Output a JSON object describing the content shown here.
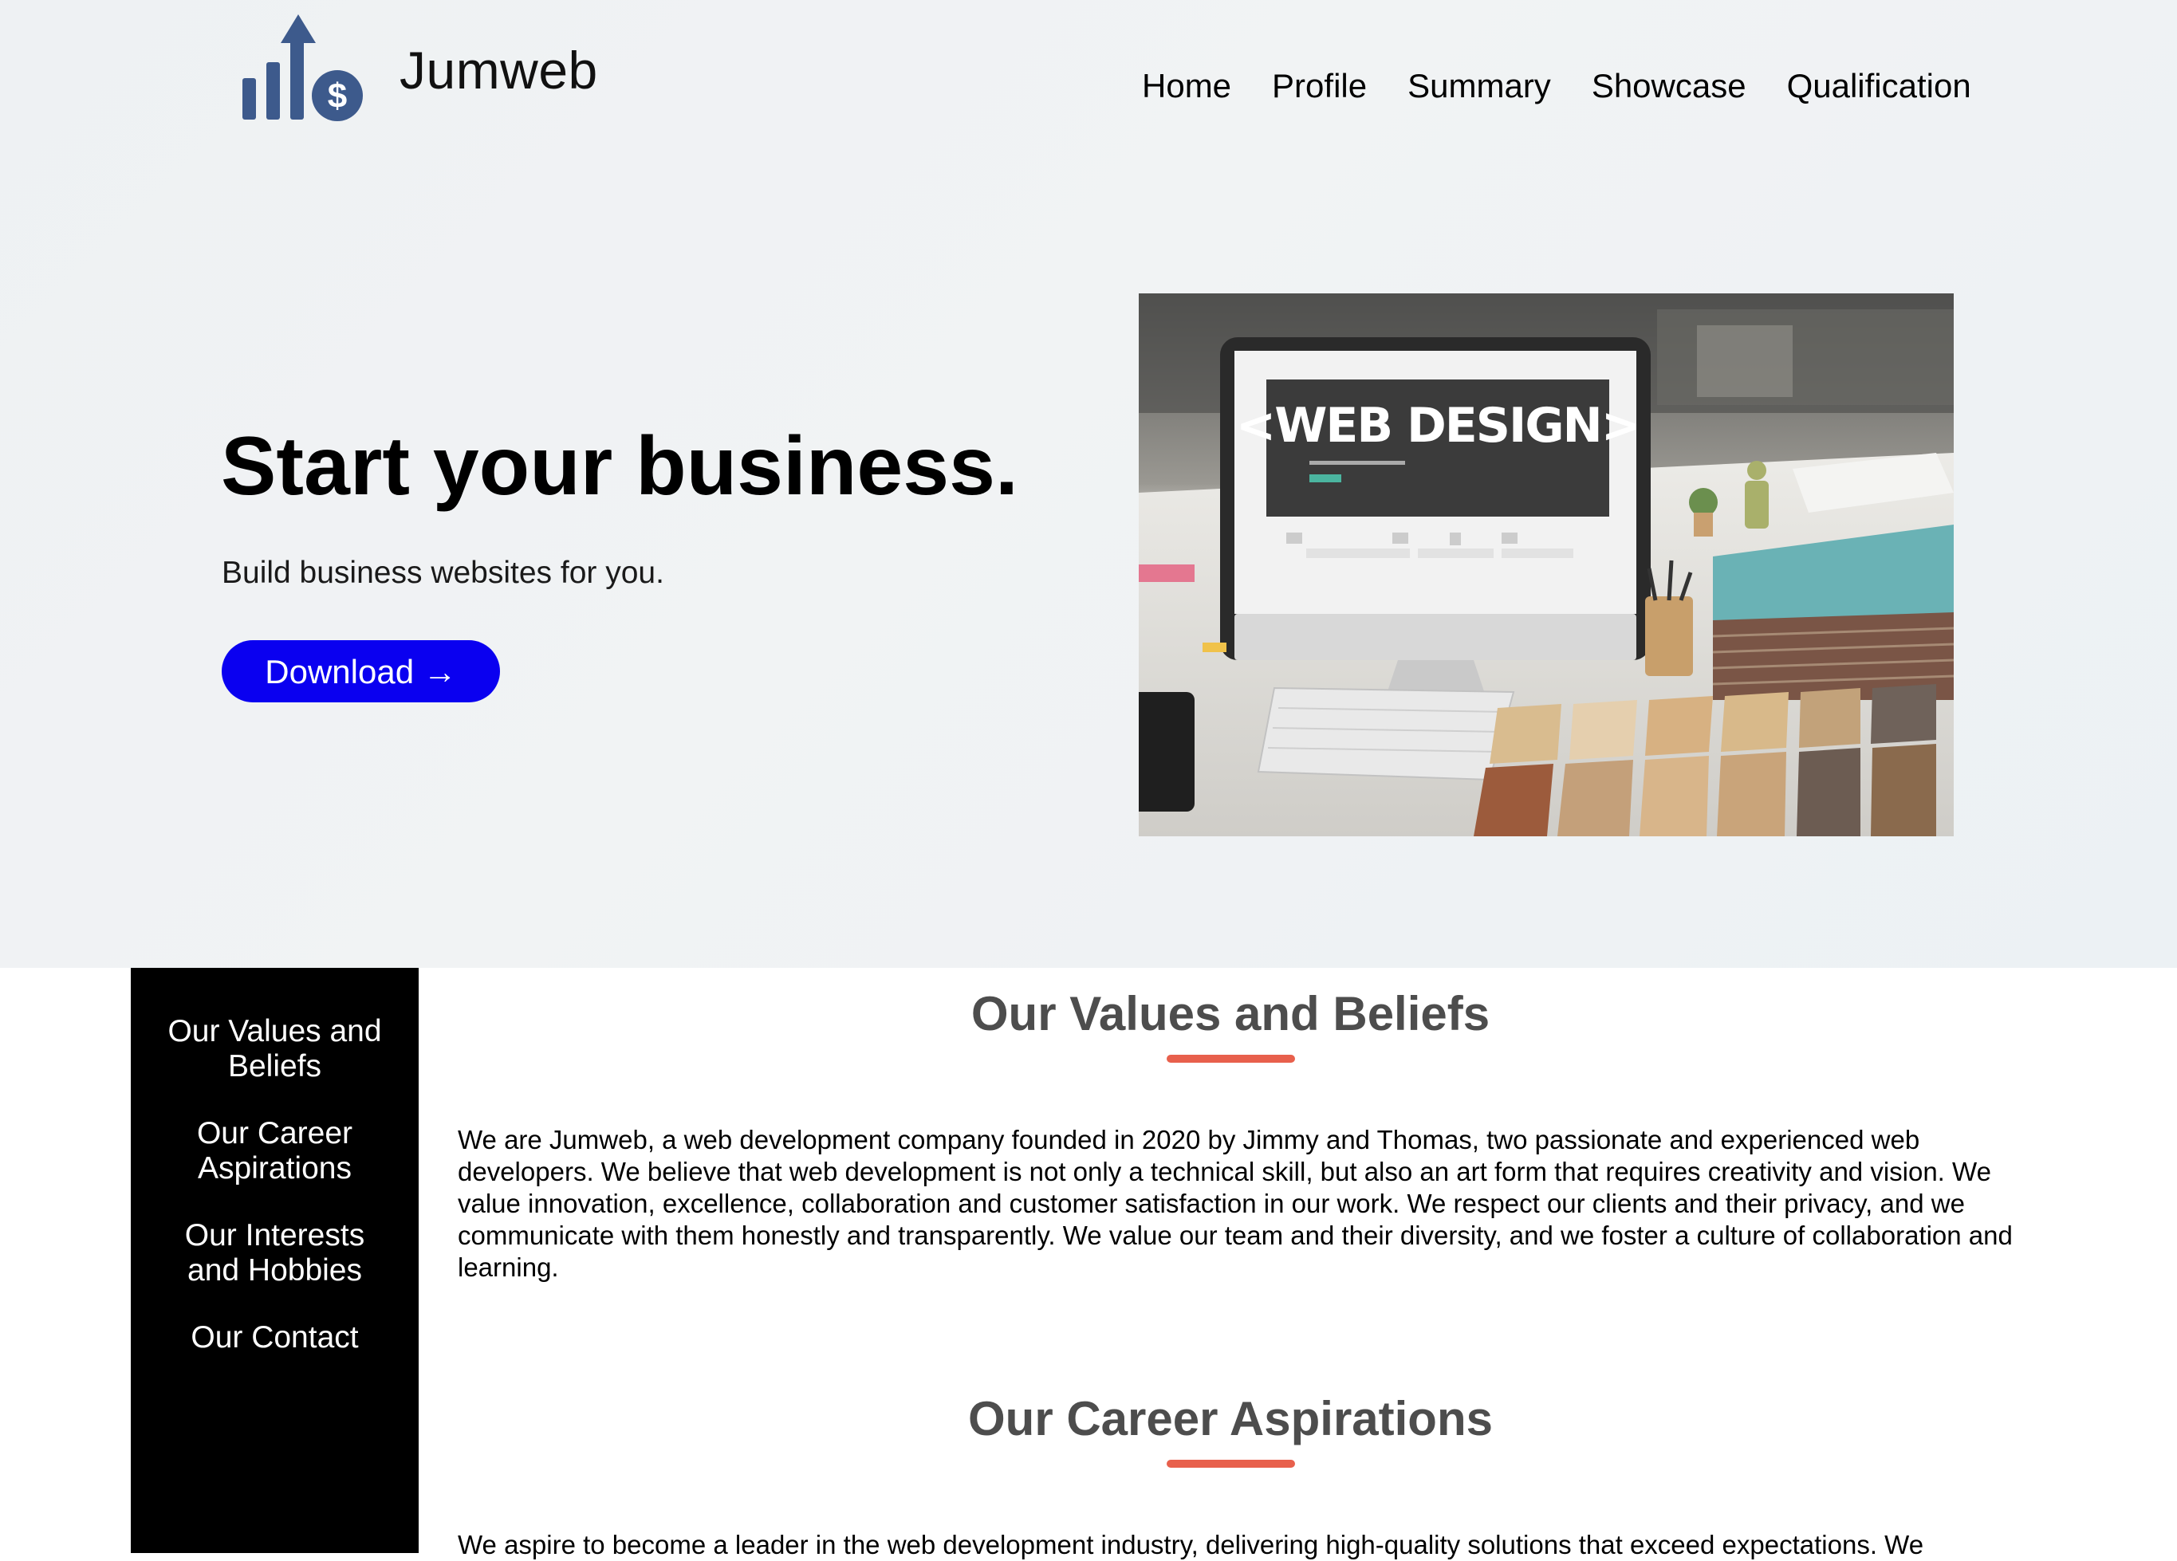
{
  "header": {
    "brand": "Jumweb",
    "nav": [
      "Home",
      "Profile",
      "Summary",
      "Showcase",
      "Qualification"
    ]
  },
  "hero": {
    "title": "Start your business.",
    "subtitle": "Build business websites for you.",
    "button_label": "Download →",
    "image_text": "<WEB DESIGN>"
  },
  "sidebar": {
    "items": [
      "Our Values and Beliefs",
      "Our Career Aspirations",
      "Our Interests and Hobbies",
      "Our Contact"
    ]
  },
  "sections": [
    {
      "title": "Our Values and Beliefs",
      "text": "We are Jumweb, a web development company founded in 2020 by Jimmy and Thomas, two passionate and experienced web developers. We believe that web development is not only a technical skill, but also an art form that requires creativity and vision. We value innovation, excellence, collaboration and customer satisfaction in our work. We respect our clients and their privacy, and we communicate with them honestly and transparently. We value our team and their diversity, and we foster a culture of collaboration and learning."
    },
    {
      "title": "Our Career Aspirations",
      "text": "We aspire to become a leader in the web development industry, delivering high-quality solutions that exceed expectations. We"
    }
  ],
  "colors": {
    "accent_button": "#0a00f0",
    "logo": "#3d5a8c",
    "underline": "#e8604c",
    "sidebar_bg": "#000000"
  }
}
